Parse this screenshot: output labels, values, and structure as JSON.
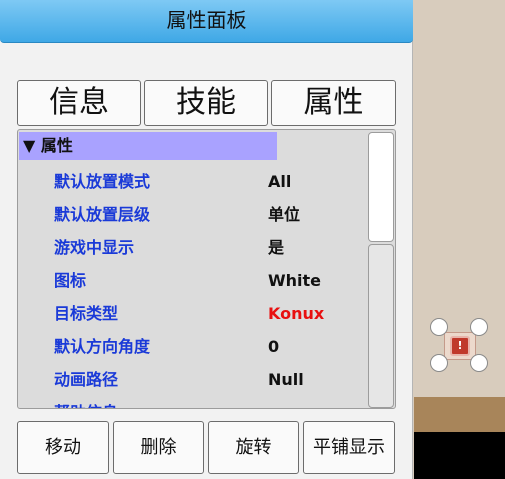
{
  "panel": {
    "title": "属性面板",
    "tabs": [
      {
        "label": "信息"
      },
      {
        "label": "技能"
      },
      {
        "label": "属性"
      }
    ],
    "section": {
      "label": "▼ 属性",
      "rows": [
        {
          "key": "默认放置模式",
          "value": "All"
        },
        {
          "key": "默认放置层级",
          "value": "单位"
        },
        {
          "key": "游戏中显示",
          "value": "是"
        },
        {
          "key": "图标",
          "value": "White"
        },
        {
          "key": "目标类型",
          "value": "Konux",
          "value_color": "#e81010"
        },
        {
          "key": "默认方向角度",
          "value": "0"
        },
        {
          "key": "动画路径",
          "value": "Null"
        },
        {
          "key": "帮助信息",
          "value": ""
        }
      ]
    },
    "actions": [
      {
        "label": "移动"
      },
      {
        "label": "删除"
      },
      {
        "label": "旋转"
      },
      {
        "label": "平铺显示"
      }
    ]
  },
  "scene": {
    "selected_unit_badge": "!"
  },
  "colors": {
    "title_bar": "#3fa8e6",
    "section_header": "#a9a2ff",
    "key_text": "#1a3ad8",
    "highlight_value": "#e81010"
  }
}
